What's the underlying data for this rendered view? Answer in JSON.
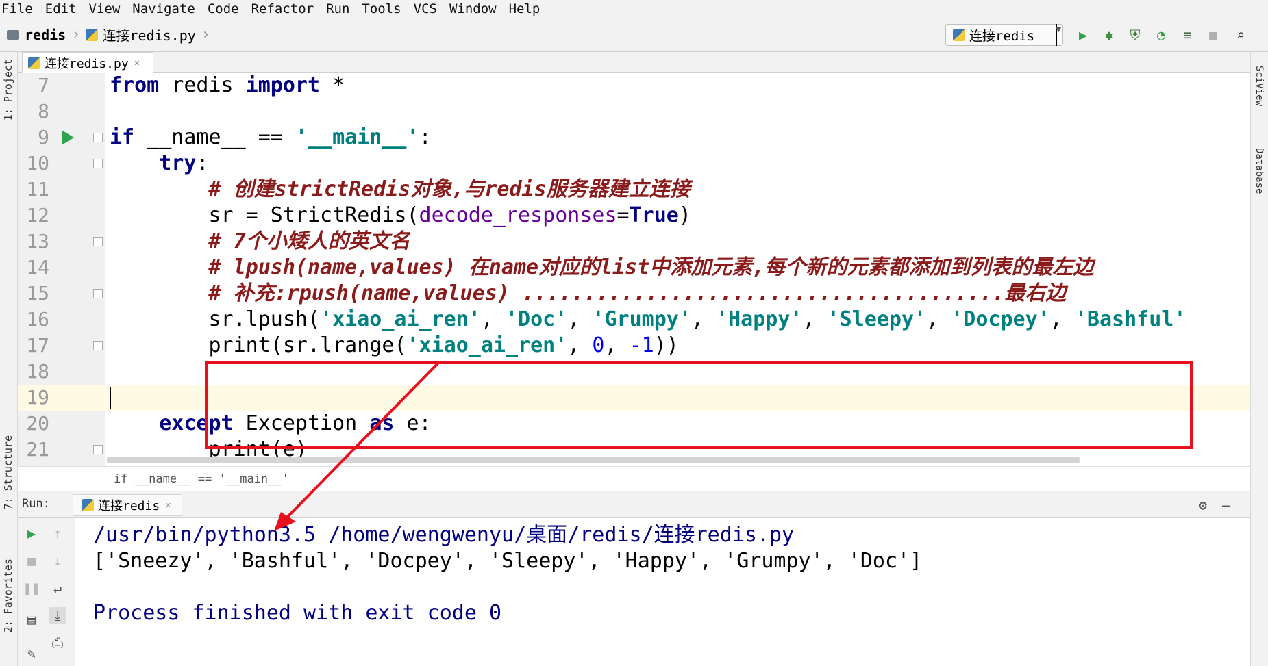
{
  "menu": [
    "File",
    "Edit",
    "View",
    "Navigate",
    "Code",
    "Refactor",
    "Run",
    "Tools",
    "VCS",
    "Window",
    "Help"
  ],
  "nav": {
    "project": "redis",
    "file": "连接redis.py",
    "run_config": "连接redis"
  },
  "editor_tab": {
    "label": "连接redis.py"
  },
  "left_tools": {
    "project": "1: Project",
    "structure": "7: Structure",
    "favorites": "2: Favorites"
  },
  "right_tools": {
    "sciview": "SciView",
    "database": "Database"
  },
  "code": {
    "lines": [
      {
        "n": "7"
      },
      {
        "n": "8"
      },
      {
        "n": "9"
      },
      {
        "n": "10"
      },
      {
        "n": "11"
      },
      {
        "n": "12"
      },
      {
        "n": "13"
      },
      {
        "n": "14"
      },
      {
        "n": "15"
      },
      {
        "n": "16"
      },
      {
        "n": "17"
      },
      {
        "n": "18"
      },
      {
        "n": "19"
      },
      {
        "n": "20"
      },
      {
        "n": "21"
      }
    ],
    "t": {
      "from": "from",
      "redis": " redis ",
      "import": "import",
      "star": " *",
      "if": "if",
      "name_eq": " __name__ == ",
      "main_str": "'__main__'",
      "colon": ":",
      "try": "try",
      "c11": "# 创建strictRedis对象,与redis服务器建立连接",
      "sr_eq": "sr = StrictRedis(",
      "decode": "decode_responses",
      "eq": "=",
      "true": "True",
      "rparen": ")",
      "c13": "# 7个小矮人的英文名",
      "c14": "# lpush(name,values) 在name对应的list中添加元素,每个新的元素都添加到列表的最左边",
      "c15": "# 补充:rpush(name,values) .......................................最右边",
      "lpush": "sr.lpush(",
      "s_xar": "'xiao_ai_ren'",
      "comma": ", ",
      "s_doc": "'Doc'",
      "s_grumpy": "'Grumpy'",
      "s_happy": "'Happy'",
      "s_sleepy": "'Sleepy'",
      "s_docpey": "'Docpey'",
      "s_bashful": "'Bashful'",
      "print_lrange": "print(sr.lrange(",
      "zero": "0",
      "neg1": "-1",
      "rr": "))",
      "except": "except",
      "exc": " Exception ",
      "as": "as",
      "e": " e:",
      "print_e": "print(e)"
    }
  },
  "code_crumb": "if __name__ == '__main__'",
  "run_panel": {
    "title": "Run:",
    "tab": "连接redis",
    "console": [
      "/usr/bin/python3.5 /home/wengwenyu/桌面/redis/连接redis.py",
      "['Sneezy', 'Bashful', 'Docpey', 'Sleepy', 'Happy', 'Grumpy', 'Doc']",
      "",
      "Process finished with exit code 0"
    ]
  },
  "colors": {
    "highlight": "#e8101c",
    "keyword": "#000080",
    "string": "#008080",
    "comment": "#8b1a1a",
    "run_green": "#2fa44f"
  }
}
